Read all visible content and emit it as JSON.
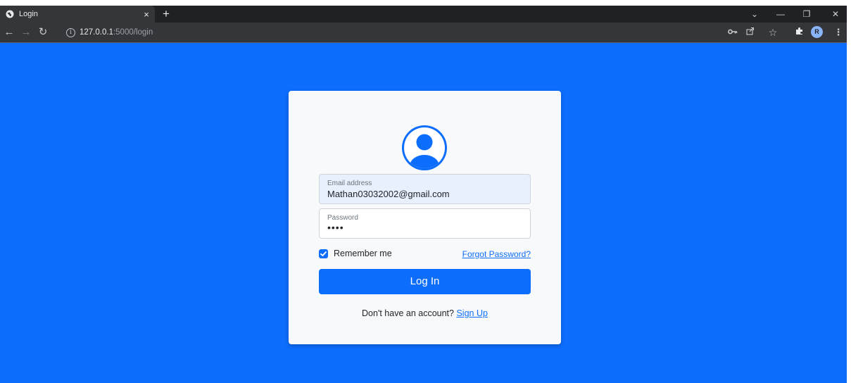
{
  "browser": {
    "tab_title": "Login",
    "tab_close": "×",
    "new_tab": "+",
    "url_host": "127.0.0.1",
    "url_path": ":5000/login",
    "profile_initial": "R",
    "window_controls": {
      "tab_search": "⌄",
      "minimize": "—",
      "restore": "❐",
      "close": "✕"
    }
  },
  "login": {
    "email_label": "Email address",
    "email_value": "Mathan03032002@gmail.com",
    "password_label": "Password",
    "password_value": "••••",
    "remember_label": "Remember me",
    "remember_checked": true,
    "forgot_label": "Forgot Password?",
    "submit_label": "Log In",
    "signup_prompt": "Don't have an account?",
    "signup_link": "Sign Up"
  },
  "colors": {
    "page_bg": "#0d6efd",
    "accent": "#0d6efd",
    "card_bg": "#f8f9fa",
    "chrome_dark": "#202124",
    "chrome_toolbar": "#35363a"
  },
  "icons": [
    "globe-icon",
    "back-arrow-icon",
    "forward-arrow-icon",
    "reload-icon",
    "info-icon",
    "key-icon",
    "share-icon",
    "star-icon",
    "extensions-icon",
    "menu-icon",
    "user-circle-icon",
    "checkmark-icon"
  ]
}
